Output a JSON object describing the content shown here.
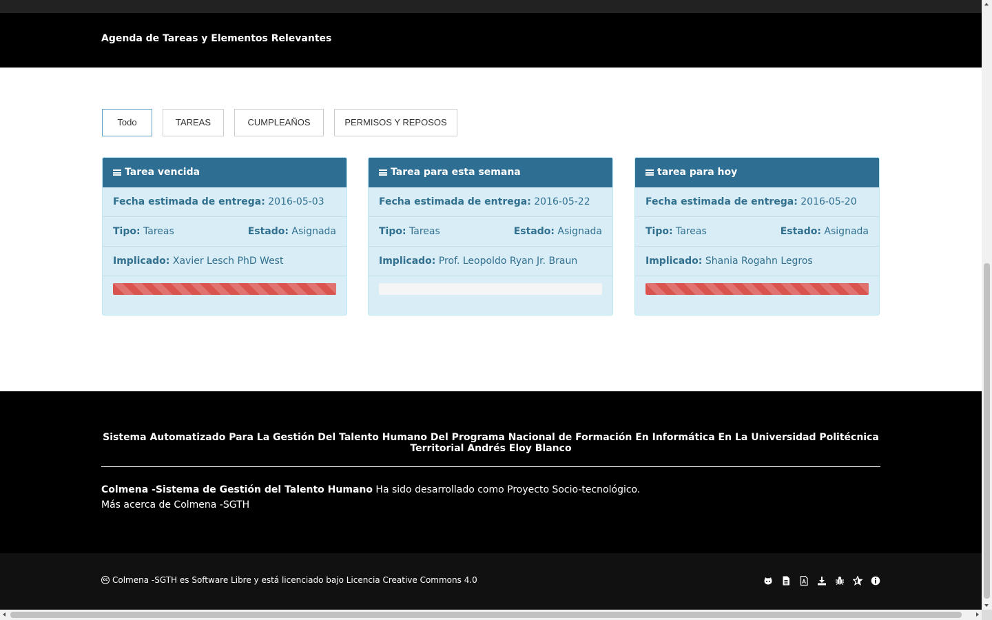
{
  "header": {
    "title": "Agenda de Tareas y Elementos Relevantes"
  },
  "filters": [
    {
      "label": "Todo",
      "active": true
    },
    {
      "label": "TAREAS",
      "active": false
    },
    {
      "label": "CUMPLEAÑOS",
      "active": false
    },
    {
      "label": "PERMISOS Y REPOSOS",
      "active": false
    }
  ],
  "labels": {
    "due_date": "Fecha estimada de entrega:",
    "type": "Tipo:",
    "status": "Estado:",
    "involved": "Implicado:"
  },
  "cards": [
    {
      "title": "Tarea vencida",
      "due_date": "2016-05-03",
      "type": "Tareas",
      "status": "Asignada",
      "involved": "Xavier Lesch PhD West",
      "progress": 1.0,
      "bar_color": "#d9534f"
    },
    {
      "title": "Tarea para esta semana",
      "due_date": "2016-05-22",
      "type": "Tareas",
      "status": "Asignada",
      "involved": "Prof. Leopoldo Ryan Jr. Braun",
      "progress": 0.0,
      "bar_color": "#d9534f"
    },
    {
      "title": "tarea para hoy",
      "due_date": "2016-05-20",
      "type": "Tareas",
      "status": "Asignada",
      "involved": "Shania Rogahn Legros",
      "progress": 1.0,
      "bar_color": "#d9534f"
    }
  ],
  "footer": {
    "title": "Sistema Automatizado Para La Gestión Del Talento Humano Del Programa Nacional de Formación En Informática En La Universidad Politécnica Territorial Andrés Eloy Blanco",
    "brand": "Colmena -Sistema de Gestión del Talento Humano",
    "description": " Ha sido desarrollado como Proyecto Socio-tecnológico.",
    "more_link": "Más acerca de Colmena -SGTH"
  },
  "bottombar": {
    "cc_icon": "cc",
    "license": "Colmena -SGTH es Software Libre y está licenciado bajo Licencia Creative Commons 4.0",
    "icons": [
      "github-icon",
      "document-icon",
      "pdf-icon",
      "download-icon",
      "bug-icon",
      "star-icon",
      "info-icon"
    ]
  },
  "colors": {
    "header_bg": "#000000",
    "card_head": "#2e6e93",
    "card_body": "#d9edf7",
    "card_text": "#31708f",
    "danger": "#d9534f"
  }
}
